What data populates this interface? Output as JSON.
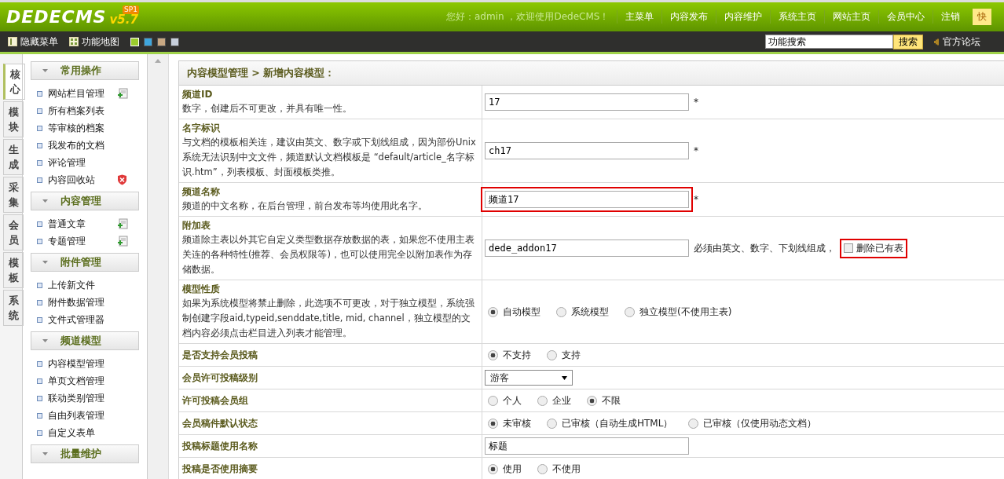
{
  "header": {
    "logo": {
      "name": "DEDECMS",
      "badge": "SP1",
      "version": "v5.7"
    },
    "greeting": "您好：admin ，欢迎使用DedeCMS！",
    "nav": [
      "主菜单",
      "内容发布",
      "内容维护",
      "系统主页",
      "网站主页",
      "会员中心",
      "注销"
    ],
    "quick": "快"
  },
  "toolbar": {
    "links": [
      "隐藏菜单",
      "功能地图"
    ],
    "skins": [
      {
        "color": "#9ccc2c",
        "selected": true
      },
      {
        "color": "#3fa6dd",
        "selected": false
      },
      {
        "color": "#c8a882",
        "selected": false
      },
      {
        "color": "#c8d0dc",
        "selected": false
      }
    ],
    "search": {
      "value": "功能搜索",
      "button": "搜索"
    },
    "forum": "官方论坛"
  },
  "side_tabs": [
    {
      "label": "核心",
      "selected": true
    },
    {
      "label": "模块",
      "selected": false
    },
    {
      "label": "生成",
      "selected": false
    },
    {
      "label": "采集",
      "selected": false
    },
    {
      "label": "会员",
      "selected": false
    },
    {
      "label": "模板",
      "selected": false
    },
    {
      "label": "系统",
      "selected": false
    }
  ],
  "menu": [
    {
      "title": "常用操作",
      "items": [
        {
          "label": "网站栏目管理",
          "kind": "add"
        },
        {
          "label": "所有档案列表"
        },
        {
          "label": "等审核的档案"
        },
        {
          "label": "我发布的文档"
        },
        {
          "label": "评论管理"
        },
        {
          "label": "内容回收站",
          "kind": "trash"
        }
      ]
    },
    {
      "title": "内容管理",
      "items": [
        {
          "label": "普通文章",
          "kind": "add"
        },
        {
          "label": "专题管理",
          "kind": "add"
        }
      ]
    },
    {
      "title": "附件管理",
      "items": [
        {
          "label": "上传新文件"
        },
        {
          "label": "附件数据管理"
        },
        {
          "label": "文件式管理器"
        }
      ]
    },
    {
      "title": "频道模型",
      "items": [
        {
          "label": "内容模型管理"
        },
        {
          "label": "单页文档管理"
        },
        {
          "label": "联动类别管理"
        },
        {
          "label": "自由列表管理"
        },
        {
          "label": "自定义表单"
        }
      ]
    },
    {
      "title": "批量维护"
    }
  ],
  "form": {
    "title": "内容模型管理 > 新增内容模型：",
    "rows": [
      {
        "label": "频道ID",
        "description": "数字，创建后不可更改，并具有唯一性。",
        "control": {
          "kind": "input",
          "value": "17",
          "required_mark": "*"
        }
      },
      {
        "label": "名字标识",
        "description": "与文档的模板相关连，建议由英文、数字或下划线组成，因为部份Unix系统无法识别中文文件，频道默认文档模板是 “default/article_名字标识.htm”，列表模板、封面模板类推。",
        "control": {
          "kind": "input",
          "value": "ch17",
          "required_mark": "*"
        }
      },
      {
        "label": "频道名称",
        "description": "频道的中文名称，在后台管理，前台发布等均使用此名字。",
        "control": {
          "kind": "input",
          "value": "频道17",
          "required_mark": "*",
          "highlighted": true
        }
      },
      {
        "label": "附加表",
        "description": "频道除主表以外其它自定义类型数据存放数据的表，如果您不使用主表关连的各种特性(推荐、会员权限等)，也可以使用完全以附加表作为存储数据。",
        "control": {
          "kind": "table",
          "value": "dede_addon17",
          "note": "必须由英文、数字、下划线组成，",
          "checkbox": {
            "label": "删除已有表",
            "checked": false,
            "highlighted": true
          }
        }
      },
      {
        "label": "模型性质",
        "description": "如果为系统模型将禁止删除，此选项不可更改，对于独立模型，系统强制创建字段aid,typeid,senddate,title, mid, channel，独立模型的文档内容必须点击栏目进入列表才能管理。",
        "control": {
          "kind": "radios",
          "options": [
            {
              "label": "自动模型",
              "selected": true
            },
            {
              "label": "系统模型",
              "selected": false
            },
            {
              "label": "独立模型(不使用主表)",
              "selected": false
            }
          ]
        }
      },
      {
        "label": "是否支持会员投稿",
        "control": {
          "kind": "radios",
          "options": [
            {
              "label": "不支持",
              "selected": true
            },
            {
              "label": "支持",
              "selected": false
            }
          ]
        }
      },
      {
        "label": "会员许可投稿级别",
        "control": {
          "kind": "select",
          "value": "游客"
        }
      },
      {
        "label": "许可投稿会员组",
        "control": {
          "kind": "radios",
          "options": [
            {
              "label": "个人",
              "selected": false
            },
            {
              "label": "企业",
              "selected": false
            },
            {
              "label": "不限",
              "selected": true
            }
          ]
        }
      },
      {
        "label": "会员稿件默认状态",
        "control": {
          "kind": "radios",
          "options": [
            {
              "label": "未审核",
              "selected": true
            },
            {
              "label": "已审核（自动生成HTML）",
              "selected": false
            },
            {
              "label": "已审核（仅使用动态文档）",
              "selected": false
            }
          ]
        }
      },
      {
        "label": "投稿标题使用名称",
        "control": {
          "kind": "input",
          "value": "标题"
        }
      },
      {
        "label": "投稿是否使用摘要",
        "control": {
          "kind": "radios",
          "options": [
            {
              "label": "使用",
              "selected": true
            },
            {
              "label": "不使用",
              "selected": false
            }
          ]
        }
      }
    ]
  }
}
